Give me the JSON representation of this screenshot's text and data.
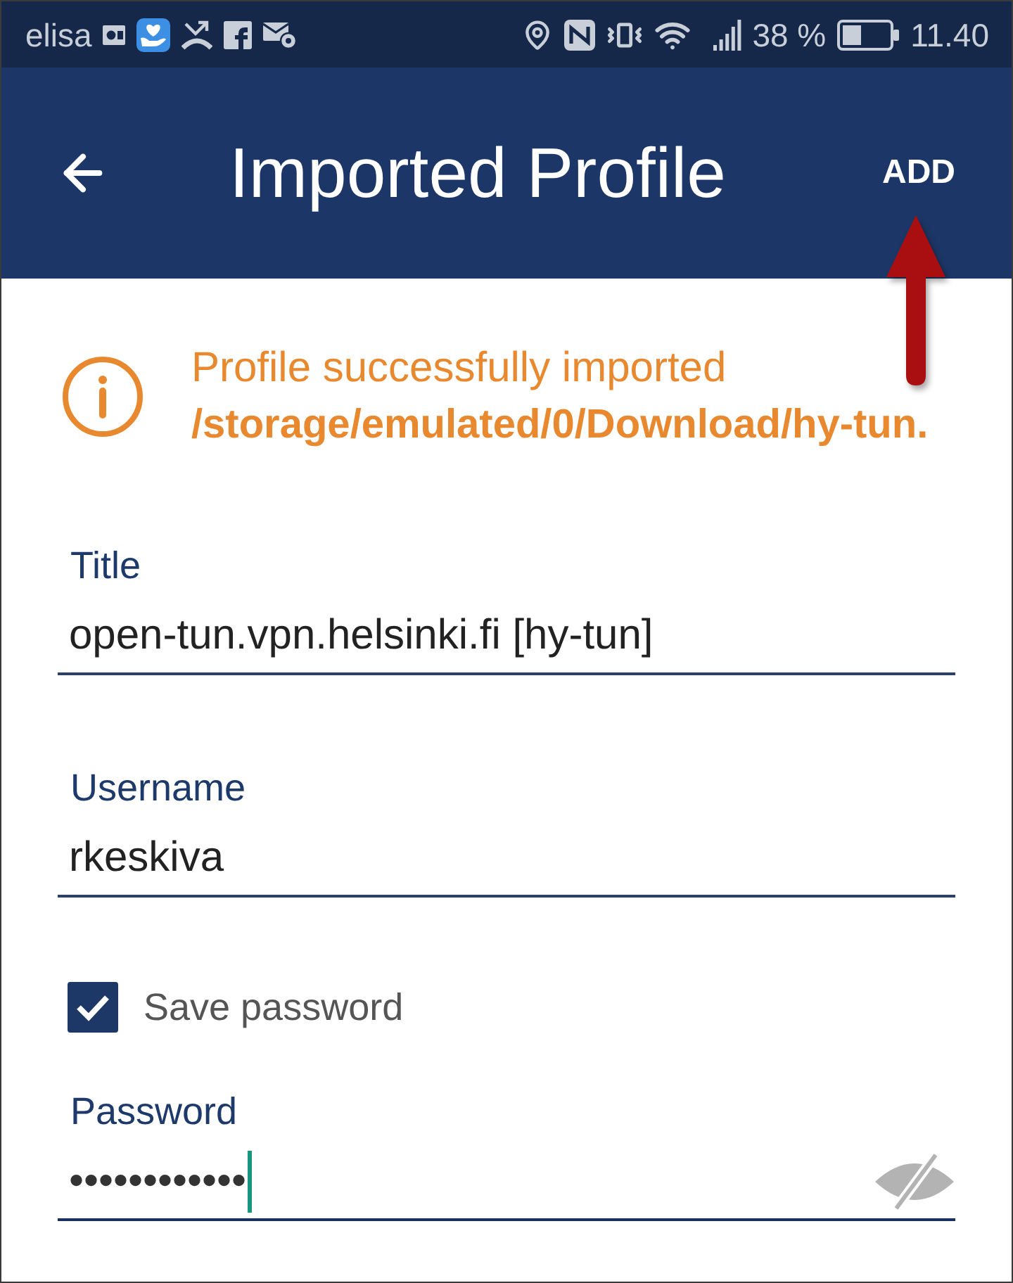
{
  "status_bar": {
    "carrier": "elisa",
    "battery": "38 %",
    "time": "11.40"
  },
  "app_bar": {
    "title": "Imported Profile",
    "action": "ADD"
  },
  "notice": {
    "message": "Profile successfully imported",
    "path": "/storage/emulated/0/Download/hy-tun."
  },
  "fields": [
    {
      "kind": "text",
      "label": "Title",
      "value": "open-tun.vpn.helsinki.fi [hy-tun]",
      "focused": false
    },
    {
      "kind": "text",
      "label": "Username",
      "value": "rkeskiva",
      "focused": false
    },
    {
      "kind": "checkbox",
      "label": "Save password",
      "checked": true
    },
    {
      "kind": "password",
      "label": "Password",
      "value": "••••••••••••",
      "focused": true
    }
  ]
}
